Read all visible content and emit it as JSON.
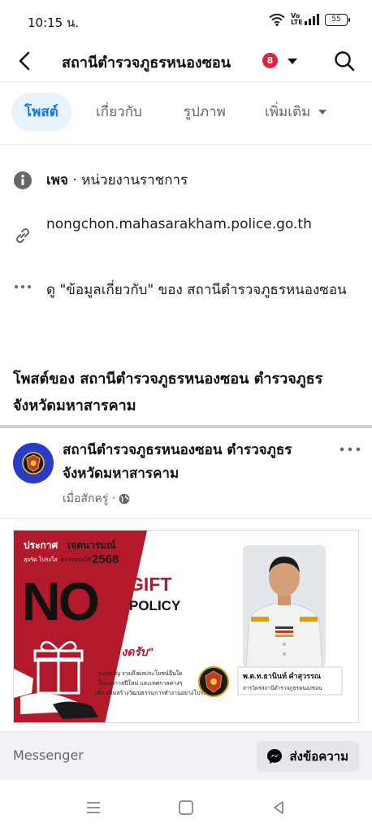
{
  "status_bar": {
    "time": "10:15 น.",
    "volte_label": "Vo LTE",
    "battery_level": "55"
  },
  "header": {
    "title": "สถานีตำรวจภูธรหนองซอน",
    "notification_count": "8"
  },
  "tabs": [
    {
      "label": "โพสต์",
      "active": true
    },
    {
      "label": "เกี่ยวกับ",
      "active": false
    },
    {
      "label": "รูปภาพ",
      "active": false
    },
    {
      "label": "เพิ่มเติม",
      "active": false
    }
  ],
  "about": {
    "page_label": "เพจ",
    "category": " · หน่วยงานราชการ",
    "website": "nongchon.mahasarakham.police.go.th",
    "see_about": "ดู \"ข้อมูลเกี่ยวกับ\" ของ สถานีตำรวจภูธรหนองซอน"
  },
  "posts_heading": "โพสต์ของ สถานีตำรวจภูธรหนองซอน ตำรวจภูธรจังหวัดมหาสารคาม",
  "post": {
    "author": "สถานีตำรวจภูธรหนองซอน ตำรวจภูธรจังหวัดมหาสารคาม",
    "time": "เมื่อสักครู่ ·",
    "image": {
      "announce": "ประกาศ",
      "intent": "เจตนารมณ์",
      "line2a": "สุจริต โปร่งใส",
      "line2b": "ตรวจสอบได้",
      "year": "2568",
      "no": "NO",
      "gift": "GIFT",
      "policy": "POLICY",
      "slogan": "\"งดให้ งดรับ\"",
      "desc1": "ของขวัญ รวมถึงผลประโยชน์อื่นใด",
      "desc2": "ในเทศกาลปีใหม่ และเทศกาลต่างๆ",
      "desc3": "เพื่อเสริมสร้างวัฒนธรรมการทำงานอย่างโปร่งใส",
      "officer_name": "พ.ต.ท.ธานินท์ คำสุวรรณ",
      "officer_title": "สารวัตรสถานีตำรวจภูธรหนองซอน"
    }
  },
  "messenger": {
    "label": "Messenger",
    "send_label": "ส่งข้อความ"
  },
  "colors": {
    "accent": "#1877f2",
    "badge": "#e41e3f",
    "poster_red": "#b21a2b"
  }
}
